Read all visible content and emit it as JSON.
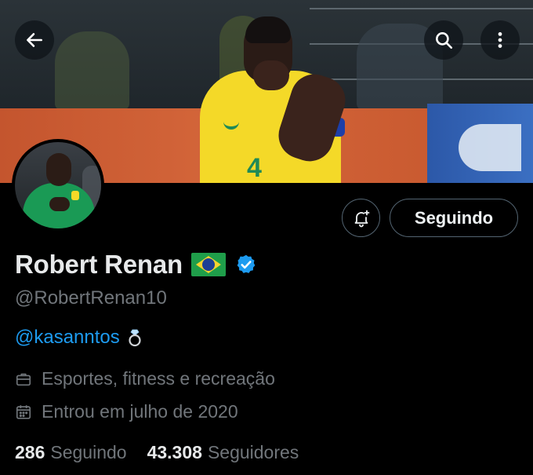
{
  "header": {
    "back_icon": "arrow-left-icon",
    "search_icon": "search-icon",
    "more_icon": "more-vertical-icon"
  },
  "banner": {
    "shirt_number": "4"
  },
  "actions": {
    "notify_icon": "bell-plus-icon",
    "follow_label": "Seguindo"
  },
  "profile": {
    "display_name": "Robert Renan",
    "flag_icon": "brazil-flag-icon",
    "verified_icon": "verified-badge-icon",
    "handle": "@RobertRenan10",
    "bio_mention": "@kasanntos",
    "bio_emoji_icon": "ring-icon",
    "category": "Esportes, fitness e recreação",
    "joined": "Entrou em julho de 2020"
  },
  "stats": {
    "following_count": "286",
    "following_label": "Seguindo",
    "followers_count": "43.308",
    "followers_label": "Seguidores"
  },
  "colors": {
    "background": "#000000",
    "text_primary": "#e7e9ea",
    "text_secondary": "#71767b",
    "link": "#1d9bf0",
    "border": "#536471",
    "verified": "#1d9bf0"
  }
}
